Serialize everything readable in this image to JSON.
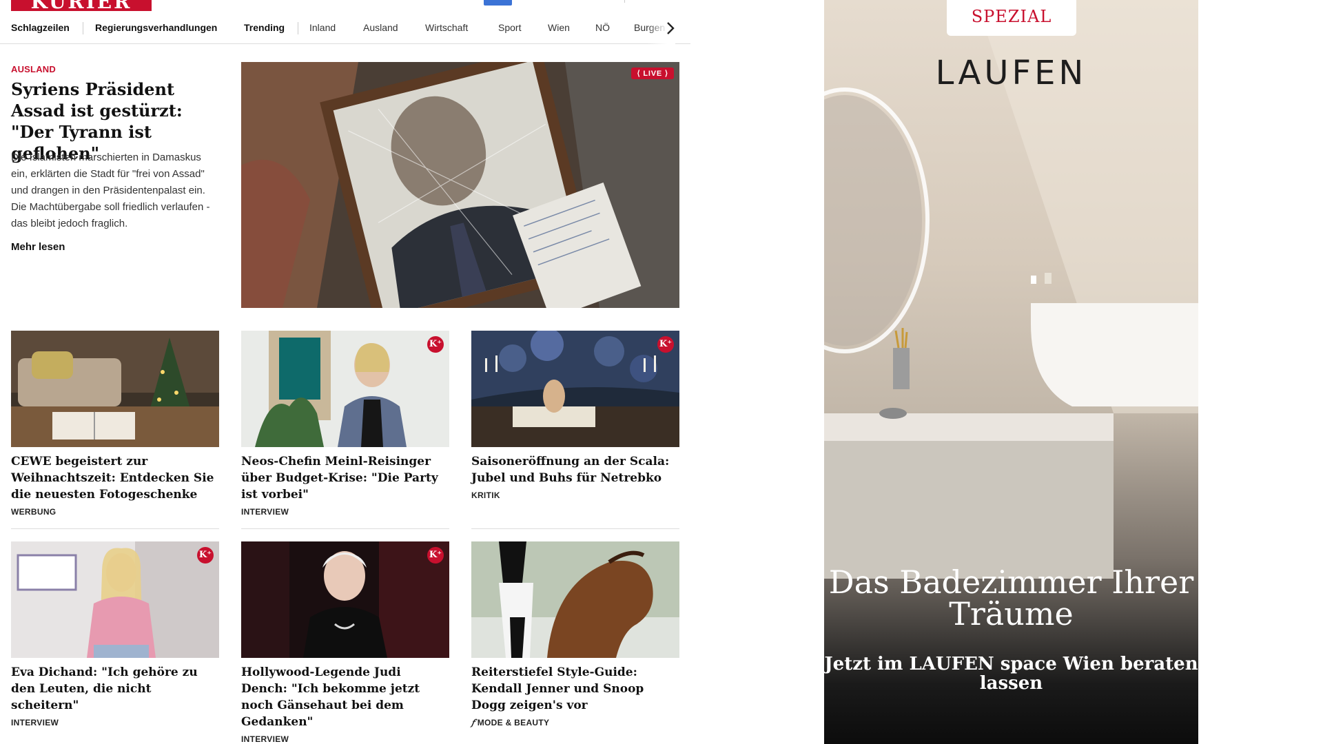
{
  "site": {
    "logo": "KURIER"
  },
  "nav": [
    "Schlagzeilen",
    "Regierungsverhandlungen",
    "Trending",
    "Inland",
    "Ausland",
    "Wirtschaft",
    "Sport",
    "Wien",
    "NÖ",
    "Burgen"
  ],
  "hero": {
    "kicker": "AUSLAND",
    "title": "Syriens Präsident Assad ist gestürzt: \"Der Tyrann ist geflohen\"",
    "text": "Die Islamisten marschierten in Damaskus ein, erklärten die Stadt für \"frei von Assad\" und drangen in den Präsidentenpalast ein. Die Machtübergabe soll friedlich verlaufen - das bleibt jedoch fraglich.",
    "read_more": "Mehr lesen",
    "live": "LIVE"
  },
  "cards": [
    {
      "title": "CEWE begeistert zur Weihnachts­zeit: Entdecken Sie die neuesten Fotogeschenke",
      "tag": "WERBUNG",
      "plus": false
    },
    {
      "title": "Neos-Chefin Meinl-Reisinger über Budget-Krise: \"Die Party ist vorbei\"",
      "tag": "INTERVIEW",
      "plus": true
    },
    {
      "title": "Saisoneröffnung an der Scala: Ju­bel und Buhs für Netrebko",
      "tag": "KRITIK",
      "plus": true
    },
    {
      "title": "Eva Dichand: \"Ich gehöre zu den Leuten, die nicht scheitern\"",
      "tag": "INTERVIEW",
      "plus": true
    },
    {
      "title": "Hollywood-Legende Judi Dench: \"Ich bekomme jetzt noch Gänse­haut bei dem Gedanken\"",
      "tag": "INTERVIEW",
      "plus": true
    },
    {
      "title": "Reiterstiefel Style-Guide: Kendall Jenner und Snoop Dogg zeigen's vor",
      "tag": "MODE & BEAUTY",
      "plus": false
    }
  ],
  "badges": {
    "plus": "K⁺"
  },
  "ad": {
    "label": "SPEZIAL",
    "brand": "LAUFEN",
    "headline": "Das Badezimmer Ihrer Träume",
    "sub": "Jetzt im LAUFEN space Wien beraten lassen"
  },
  "colors": {
    "brand_red": "#c8102e",
    "accent_blue": "#3b73d6"
  }
}
